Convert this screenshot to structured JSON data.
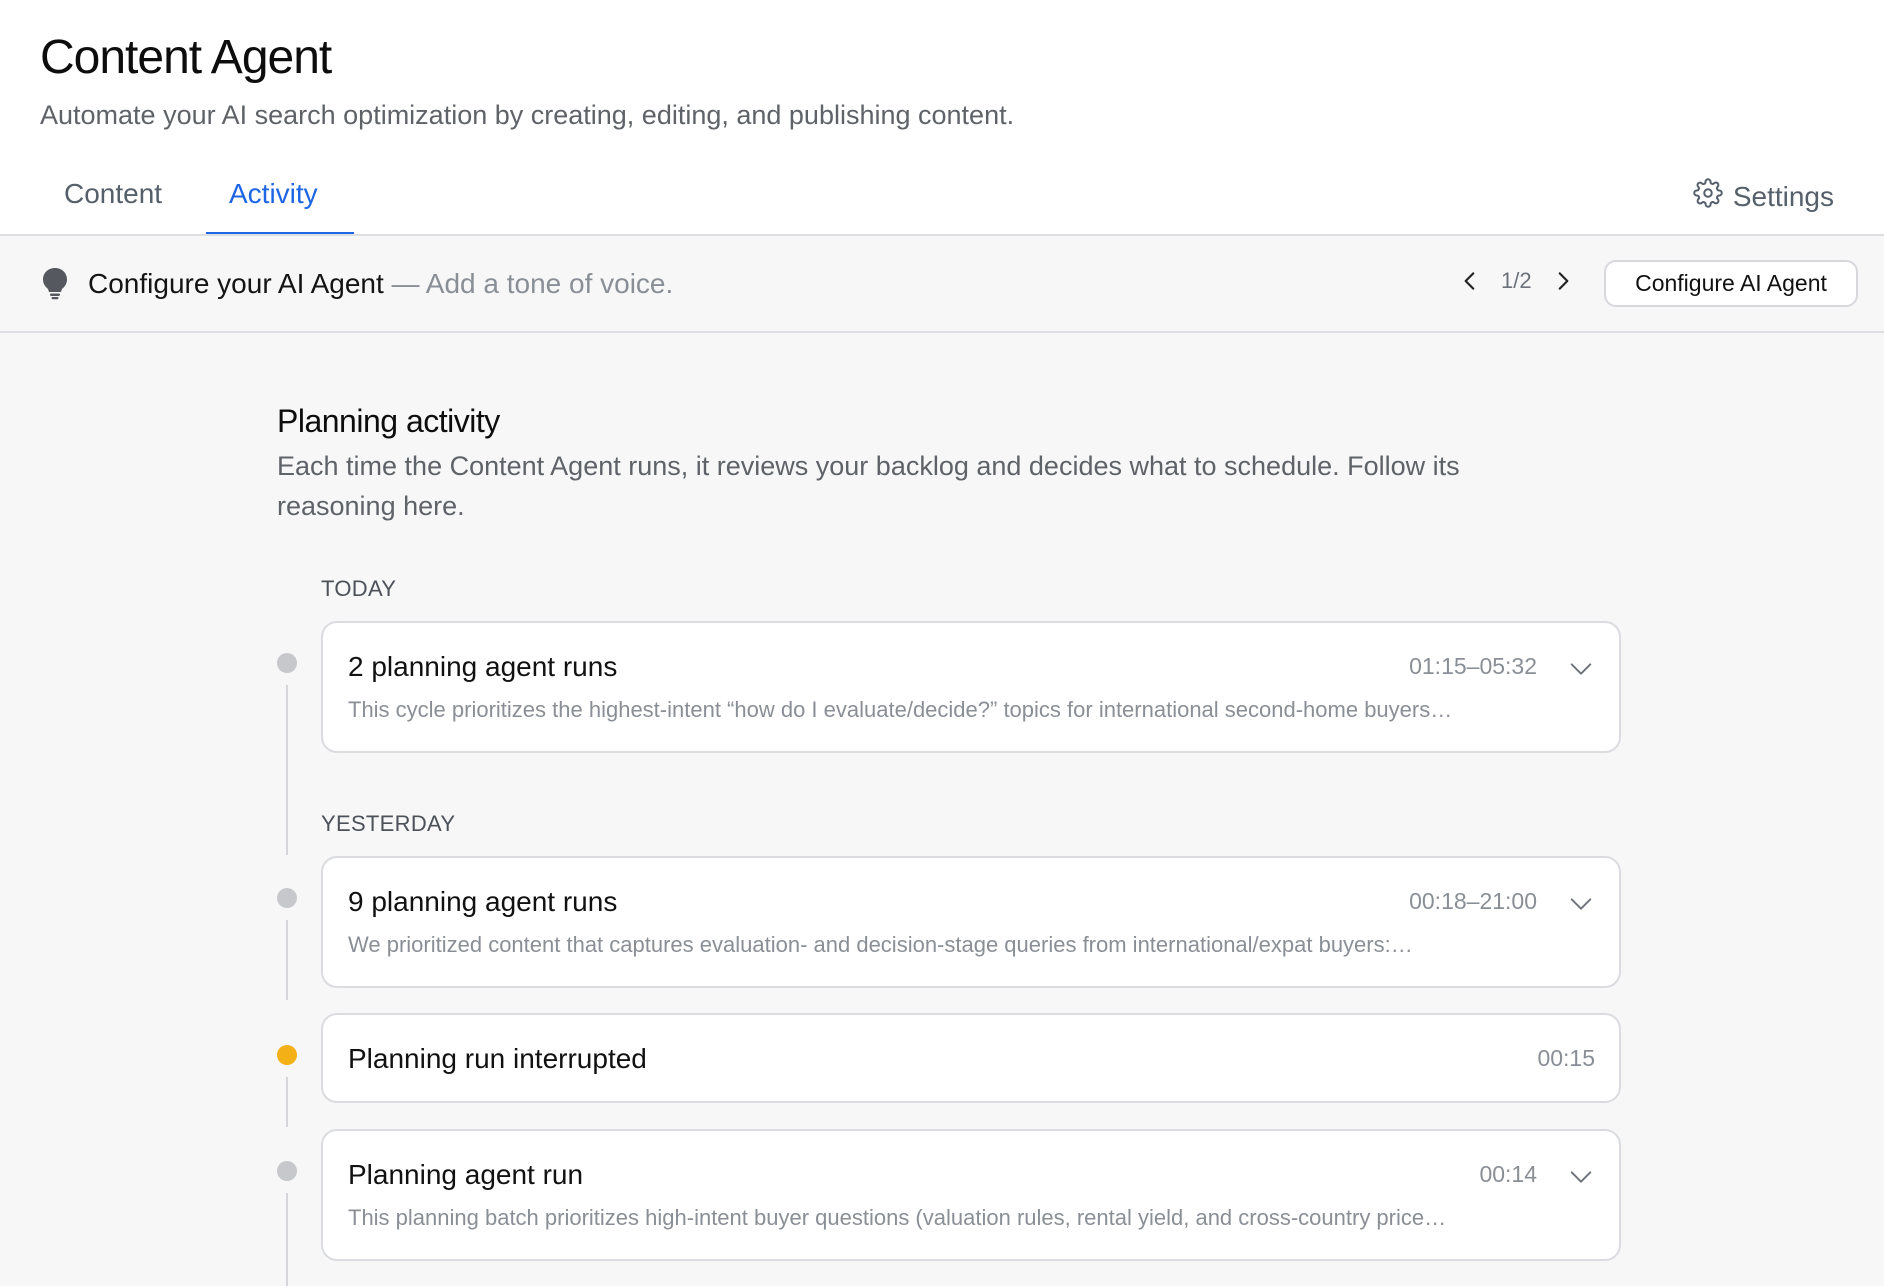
{
  "header": {
    "title": "Content Agent",
    "subtitle": "Automate your AI search optimization by creating, editing, and publishing content."
  },
  "tabs": [
    {
      "label": "Content",
      "active": false
    },
    {
      "label": "Activity",
      "active": true
    }
  ],
  "settings": {
    "label": "Settings",
    "icon": "gear-icon"
  },
  "banner": {
    "icon": "lightbulb-icon",
    "title": "Configure your AI Agent",
    "separator": " — ",
    "message": "Add a tone of voice.",
    "pager": "1/2",
    "button_label": "Configure AI Agent"
  },
  "activity": {
    "title": "Planning activity",
    "description": "Each time the Content Agent runs, it reviews your backlog and decides what to schedule. Follow its reasoning here.",
    "groups": [
      {
        "label": "TODAY",
        "items": [
          {
            "title": "2 planning agent runs",
            "time": "01:15–05:32",
            "summary": "This cycle prioritizes the highest-intent “how do I evaluate/decide?” topics for international second-home buyers…"
          }
        ]
      },
      {
        "label": "YESTERDAY",
        "items": [
          {
            "title": "9 planning agent runs",
            "time": "00:18–21:00",
            "summary": "We prioritized content that captures evaluation- and decision-stage queries from international/expat buyers:…"
          },
          {
            "title": "Planning run interrupted",
            "time": "00:15",
            "summary": ""
          },
          {
            "title": "Planning agent run",
            "time": "00:14",
            "summary": "This planning batch prioritizes high-intent buyer questions (valuation rules, rental yield, and cross-country price…"
          }
        ]
      }
    ]
  },
  "colors": {
    "accent": "#1f66e5",
    "dot_default": "#c7c8cb",
    "dot_warning": "#f3b017"
  }
}
